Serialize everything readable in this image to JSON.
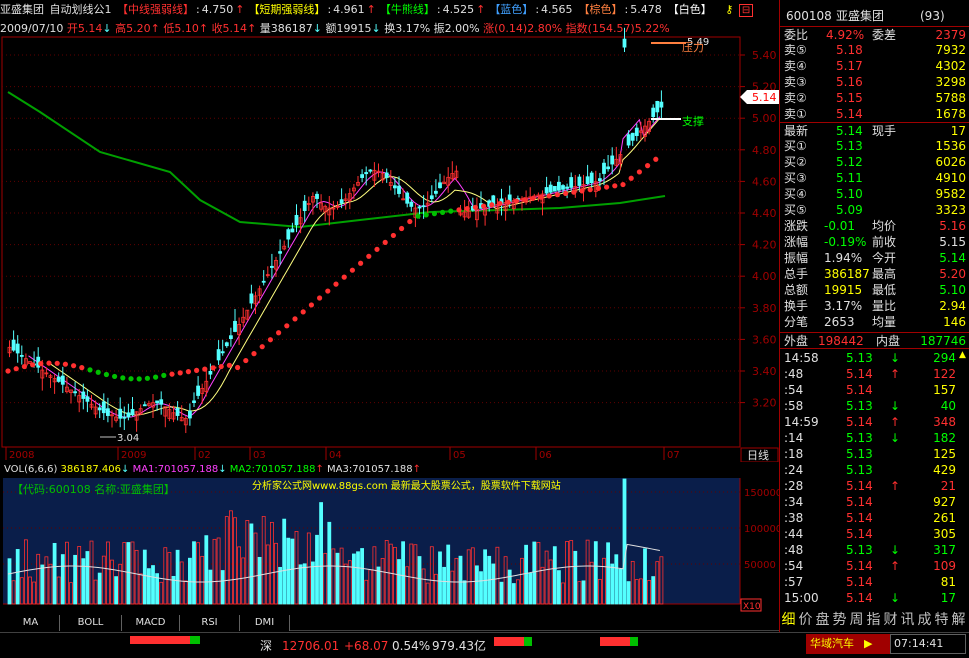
{
  "topbar": {
    "stock_name": "亚盛集团",
    "indicator_name": "自动划线公1",
    "items": [
      {
        "label": "【中线强弱线】",
        "value": "4.750",
        "arrow": "↑",
        "color": "#ff3030"
      },
      {
        "label": "【短期强弱线】",
        "value": "4.961",
        "arrow": "↑",
        "color": "#ffff00"
      },
      {
        "label": "【牛熊线】",
        "value": "4.525",
        "arrow": "↑",
        "color": "#00ff00"
      },
      {
        "label": "【蓝色】",
        "value": "4.565",
        "arrow": "",
        "color": "#40a0ff"
      },
      {
        "label": "【棕色】",
        "value": "5.478",
        "arrow": "",
        "color": "#ff8040"
      },
      {
        "label": "【白色】",
        "value": "",
        "arrow": "",
        "color": "#ffffff"
      }
    ]
  },
  "infobar": {
    "date": "2009/07/10",
    "open": "开5.14",
    "open_arrow": "↓",
    "high": "高5.20",
    "high_arrow": "↑",
    "low": "低5.10",
    "low_arrow": "↑",
    "close": "收5.14",
    "close_arrow": "↑",
    "volume": "量386187",
    "volume_arrow": "↓",
    "amount": "额19915",
    "amount_arrow": "↓",
    "turnover": "换3.17%",
    "amplitude": "振2.00%",
    "change": "涨(0.14)2.80%",
    "index": "指数(154.57)5.22%"
  },
  "price_axis": {
    "ticks": [
      "5.40",
      "5.20",
      "5.00",
      "4.80",
      "4.60",
      "4.40",
      "4.20",
      "4.00",
      "3.80",
      "3.60",
      "3.40",
      "3.20"
    ],
    "current_price": "5.14"
  },
  "annotations": {
    "high_label": "5.49",
    "pressure": "压力",
    "support": "支撑",
    "low_label": "3.04"
  },
  "date_axis": {
    "labels": [
      "2008",
      "2009",
      "02",
      "03",
      "04",
      "05",
      "06",
      "07"
    ],
    "period_button": "日线"
  },
  "volume_header": {
    "vol": "VOL(6,6,6)",
    "vol_value": "386187.406",
    "vol_arrow": "↓",
    "ma1": "MA1:701057.188",
    "ma1_arrow": "↓",
    "ma2": "MA2:701057.188",
    "ma2_arrow": "↑",
    "ma3": "MA3:701057.188",
    "ma3_arrow": "↑"
  },
  "volume_panel": {
    "code_line": "【代码:600108  名称:亚盛集团】",
    "website": "分析家公式网www.88gs.com 最新最大股票公式，股票软件下载网站",
    "axis_ticks": [
      "150000",
      "100000",
      "50000"
    ],
    "unit": "X10"
  },
  "tabs": [
    "MA",
    "BOLL",
    "MACD",
    "RSI",
    "DMI"
  ],
  "right_panel": {
    "code": "600108",
    "name": "亚盛集团",
    "rank": "(93)",
    "weibi_label": "委比",
    "weibi_value": "4.92%",
    "weicha_label": "委差",
    "weicha_value": "2379",
    "sell": [
      {
        "label": "卖⑤",
        "price": "5.18",
        "vol": "7932"
      },
      {
        "label": "卖④",
        "price": "5.17",
        "vol": "4302"
      },
      {
        "label": "卖③",
        "price": "5.16",
        "vol": "3298"
      },
      {
        "label": "卖②",
        "price": "5.15",
        "vol": "5788"
      },
      {
        "label": "卖①",
        "price": "5.14",
        "vol": "1678"
      }
    ],
    "latest_label": "最新",
    "latest_value": "5.14",
    "xianshou_label": "现手",
    "xianshou_value": "17",
    "buy": [
      {
        "label": "买①",
        "price": "5.13",
        "vol": "1536"
      },
      {
        "label": "买②",
        "price": "5.12",
        "vol": "6026"
      },
      {
        "label": "买③",
        "price": "5.11",
        "vol": "4910"
      },
      {
        "label": "买④",
        "price": "5.10",
        "vol": "9582"
      },
      {
        "label": "买⑤",
        "price": "5.09",
        "vol": "3323"
      }
    ],
    "stats": [
      {
        "l1": "涨跌",
        "v1": "-0.01",
        "c1": "#00ff00",
        "l2": "均价",
        "v2": "5.16",
        "c2": "#ff3030"
      },
      {
        "l1": "涨幅",
        "v1": "-0.19%",
        "c1": "#00ff00",
        "l2": "前收",
        "v2": "5.15",
        "c2": "#e0e0e0"
      },
      {
        "l1": "振幅",
        "v1": "1.94%",
        "c1": "#e0e0e0",
        "l2": "今开",
        "v2": "5.14",
        "c2": "#00ff00"
      },
      {
        "l1": "总手",
        "v1": "386187",
        "c1": "#ffff00",
        "l2": "最高",
        "v2": "5.20",
        "c2": "#ff3030"
      },
      {
        "l1": "总额",
        "v1": "19915",
        "c1": "#ffff00",
        "l2": "最低",
        "v2": "5.10",
        "c2": "#00ff00"
      },
      {
        "l1": "换手",
        "v1": "3.17%",
        "c1": "#e0e0e0",
        "l2": "量比",
        "v2": "2.94",
        "c2": "#ffff00"
      },
      {
        "l1": "分笔",
        "v1": "2653",
        "c1": "#e0e0e0",
        "l2": "均量",
        "v2": "146",
        "c2": "#ffff00"
      }
    ],
    "waipan_label": "外盘",
    "waipan_value": "198442",
    "neipan_label": "内盘",
    "neipan_value": "187746",
    "ticks": [
      {
        "time": "14:58",
        "price": "5.13",
        "vol": "294",
        "dir": "↓"
      },
      {
        "time": ":48",
        "price": "5.14",
        "vol": "122",
        "dir": "↑"
      },
      {
        "time": ":54",
        "price": "5.14",
        "vol": "157",
        "dir": ""
      },
      {
        "time": ":58",
        "price": "5.13",
        "vol": "40",
        "dir": "↓"
      },
      {
        "time": "14:59",
        "price": "5.14",
        "vol": "348",
        "dir": "↑"
      },
      {
        "time": ":14",
        "price": "5.13",
        "vol": "182",
        "dir": "↓"
      },
      {
        "time": ":18",
        "price": "5.13",
        "vol": "125",
        "dir": ""
      },
      {
        "time": ":24",
        "price": "5.13",
        "vol": "429",
        "dir": ""
      },
      {
        "time": ":28",
        "price": "5.14",
        "vol": "21",
        "dir": "↑"
      },
      {
        "time": ":34",
        "price": "5.14",
        "vol": "927",
        "dir": ""
      },
      {
        "time": ":38",
        "price": "5.14",
        "vol": "261",
        "dir": ""
      },
      {
        "time": ":44",
        "price": "5.14",
        "vol": "305",
        "dir": ""
      },
      {
        "time": ":48",
        "price": "5.13",
        "vol": "317",
        "dir": "↓"
      },
      {
        "time": ":54",
        "price": "5.14",
        "vol": "109",
        "dir": "↑"
      },
      {
        "time": ":57",
        "price": "5.14",
        "vol": "81",
        "dir": ""
      },
      {
        "time": "15:00",
        "price": "5.14",
        "vol": "17",
        "dir": "↓"
      }
    ],
    "bottom_tabs": [
      "细",
      "价",
      "盘",
      "势",
      "周",
      "指",
      "财",
      "讯",
      "成",
      "特",
      "解"
    ]
  },
  "statusbar": {
    "index_name": "深",
    "index_value": "12706.01",
    "index_change": "+68.07",
    "index_pct": "0.54%",
    "index_amount": "979.43亿",
    "news_ticker": "华域汽车",
    "time": "07:14:41"
  },
  "colors": {
    "up": "#ff3030",
    "down": "#54ffff",
    "bg": "#000000",
    "grid": "#a00000",
    "axis_text": "#a00000"
  }
}
